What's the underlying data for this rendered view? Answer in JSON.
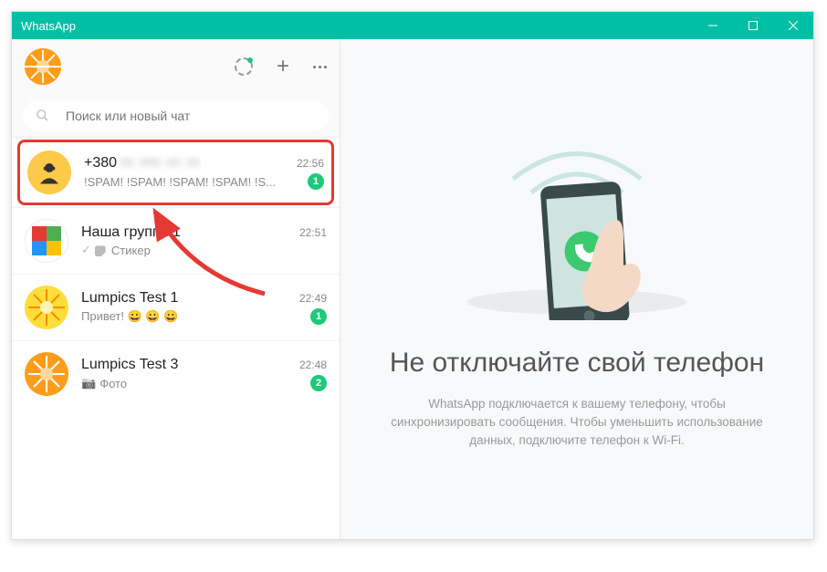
{
  "window": {
    "title": "WhatsApp"
  },
  "search": {
    "placeholder": "Поиск или новый чат"
  },
  "chats": [
    {
      "name_prefix": "+380",
      "name_blurred": "•• ••• •• ••",
      "time": "22:56",
      "preview": "!SPAM! !SPAM! !SPAM! !SPAM! !S...",
      "badge": "1"
    },
    {
      "name": "Наша группа 1",
      "time": "22:51",
      "preview": "Стикер"
    },
    {
      "name": "Lumpics Test 1",
      "time": "22:49",
      "preview": "Привет! 😀 😀 😀",
      "badge": "1"
    },
    {
      "name": "Lumpics Test 3",
      "time": "22:48",
      "preview_icon": "📷",
      "preview": "Фото",
      "badge": "2"
    }
  ],
  "main": {
    "heading": "Не отключайте свой телефон",
    "body": "WhatsApp подключается к вашему телефону, чтобы синхронизировать сообщения. Чтобы уменьшить использование данных, подключите телефон к Wi-Fi."
  }
}
